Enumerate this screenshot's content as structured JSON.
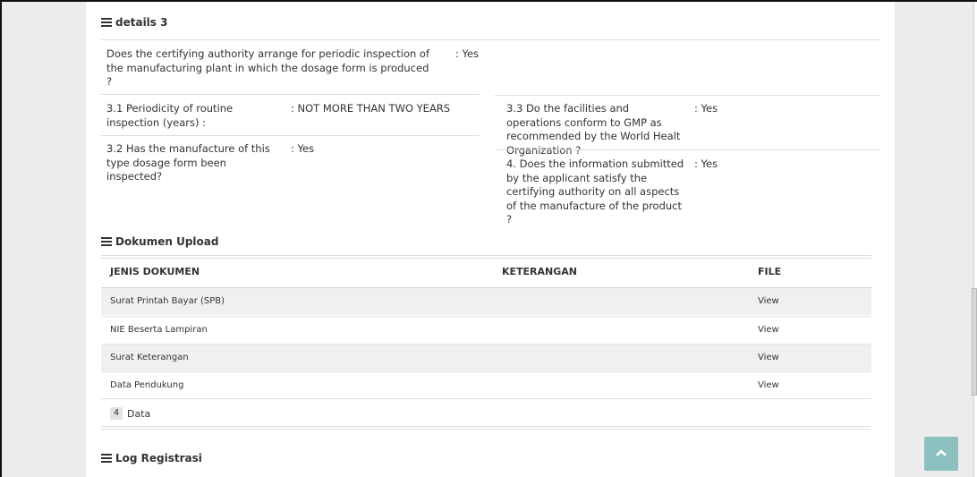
{
  "details3": {
    "title": "details 3",
    "q_main": "Does the certifying authority arrange for periodic inspection of the manufacturing plant in which the dosage form is produced ?",
    "q_main_answer": ": Yes",
    "q31": "3.1 Periodicity of routine inspection (years) :",
    "q31_answer": ": NOT MORE THAN TWO YEARS",
    "q32": "3.2 Has the manufacture of this type dosage form been inspected?",
    "q32_answer": ": Yes",
    "q33": "3.3 Do the facilities and operations conform to GMP as recommended by the World Healt Organization ?",
    "q33_answer": ": Yes",
    "q4": "4. Does the information submitted by the applicant satisfy the certifying authority on all aspects of the manufacture of the product ?",
    "q4_answer": ": Yes"
  },
  "dokumen": {
    "title": "Dokumen Upload",
    "columns": [
      "JENIS DOKUMEN",
      "KETERANGAN",
      "FILE"
    ],
    "rows": [
      {
        "jenis": "Surat Printah Bayar (SPB)",
        "keterangan": "",
        "file": "View"
      },
      {
        "jenis": "NIE Beserta Lampiran",
        "keterangan": "",
        "file": "View"
      },
      {
        "jenis": "Surat Keterangan",
        "keterangan": "",
        "file": "View"
      },
      {
        "jenis": "Data Pendukung",
        "keterangan": "",
        "file": "View"
      }
    ],
    "count": "4",
    "count_label": "Data"
  },
  "log": {
    "title": "Log Registrasi"
  },
  "icons": {
    "section": "list-icon",
    "scroll_top": "chevron-up-icon"
  },
  "colors": {
    "stripe": "#f0f0f0",
    "scroll_top": "#8cc1bf",
    "gutter": "#ececec"
  }
}
